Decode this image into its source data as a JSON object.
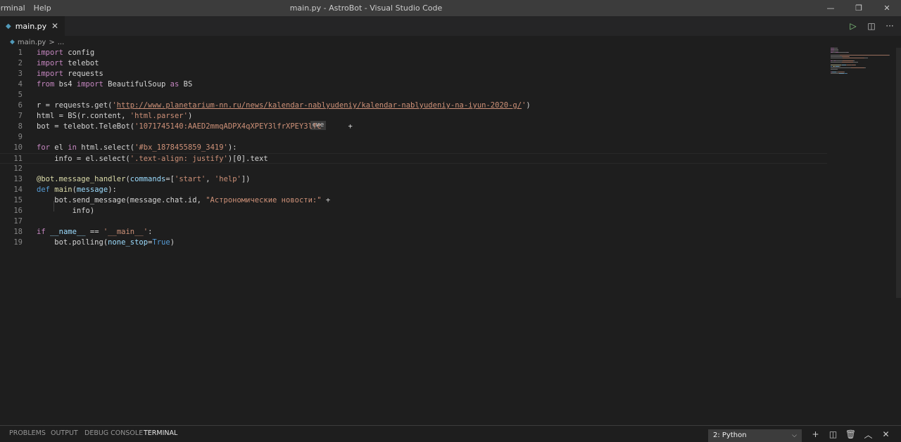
{
  "titlebar": {
    "menu": [
      "erminal",
      "Help"
    ],
    "title": "main.py - AstroBot - Visual Studio Code",
    "minimize": "—",
    "restore": "❐",
    "close": "✕"
  },
  "tabs": [
    {
      "label": "main.py",
      "close": "✕"
    }
  ],
  "tab_actions": {
    "run": "▷",
    "split": "◫",
    "more": "···"
  },
  "breadcrumb": {
    "file": "main.py",
    "sep": ">",
    "more": "..."
  },
  "editor": {
    "line_numbers": [
      "1",
      "2",
      "3",
      "4",
      "5",
      "6",
      "7",
      "8",
      "9",
      "10",
      "11",
      "12",
      "13",
      "14",
      "15",
      "16",
      "17",
      "18",
      "19"
    ],
    "lines": [
      [
        {
          "t": "import",
          "c": "kw"
        },
        {
          "t": " config",
          "c": ""
        }
      ],
      [
        {
          "t": "import",
          "c": "kw"
        },
        {
          "t": " telebot",
          "c": ""
        }
      ],
      [
        {
          "t": "import",
          "c": "kw"
        },
        {
          "t": " requests",
          "c": ""
        }
      ],
      [
        {
          "t": "from",
          "c": "kw"
        },
        {
          "t": " bs4 ",
          "c": ""
        },
        {
          "t": "import",
          "c": "kw"
        },
        {
          "t": " BeautifulSoup ",
          "c": ""
        },
        {
          "t": "as",
          "c": "kw"
        },
        {
          "t": " BS",
          "c": ""
        }
      ],
      [],
      [
        {
          "t": "r = requests.get(",
          "c": ""
        },
        {
          "t": "'",
          "c": "str"
        },
        {
          "t": "http://www.planetarium-nn.ru/news/kalendar-nablyudeniy/kalendar-nablyudeniy-na-iyun-2020-g/",
          "c": "url"
        },
        {
          "t": "'",
          "c": "str"
        },
        {
          "t": ")",
          "c": ""
        }
      ],
      [
        {
          "t": "html = BS(r.content, ",
          "c": ""
        },
        {
          "t": "'html.parser'",
          "c": "str"
        },
        {
          "t": ")",
          "c": ""
        }
      ],
      [
        {
          "t": "bot = telebot.TeleBot(",
          "c": ""
        },
        {
          "t": "'1071745140:AAED2mmqADPX4qXPEY3lfr",
          "c": "str"
        },
        {
          "t": "XPEY3lfc",
          "c": "str"
        },
        {
          "t": "      +",
          "c": ""
        }
      ],
      [],
      [
        {
          "t": "for",
          "c": "kw"
        },
        {
          "t": " el ",
          "c": ""
        },
        {
          "t": "in",
          "c": "kw"
        },
        {
          "t": " html.select(",
          "c": ""
        },
        {
          "t": "'#bx_1878455859_3419'",
          "c": "str"
        },
        {
          "t": "):",
          "c": ""
        }
      ],
      [
        {
          "t": "    info = el.select(",
          "c": ""
        },
        {
          "t": "'.text-align: justify'",
          "c": "str"
        },
        {
          "t": ")[0].text",
          "c": ""
        }
      ],
      [],
      [
        {
          "t": "@bot.message_handler",
          "c": "dec"
        },
        {
          "t": "(",
          "c": ""
        },
        {
          "t": "commands",
          "c": "param"
        },
        {
          "t": "=[",
          "c": ""
        },
        {
          "t": "'start'",
          "c": "str"
        },
        {
          "t": ", ",
          "c": ""
        },
        {
          "t": "'help'",
          "c": "str"
        },
        {
          "t": "])",
          "c": ""
        }
      ],
      [
        {
          "t": "def",
          "c": "kw2"
        },
        {
          "t": " ",
          "c": ""
        },
        {
          "t": "main",
          "c": "fn"
        },
        {
          "t": "(",
          "c": ""
        },
        {
          "t": "message",
          "c": "param"
        },
        {
          "t": "):",
          "c": ""
        }
      ],
      [
        {
          "t": "    bot.send_message(message.chat.id, ",
          "c": ""
        },
        {
          "t": "\"Астрономические новости:\"",
          "c": "str"
        },
        {
          "t": " +",
          "c": ""
        }
      ],
      [
        {
          "t": "        info)",
          "c": ""
        }
      ],
      [],
      [
        {
          "t": "if",
          "c": "kw"
        },
        {
          "t": " ",
          "c": ""
        },
        {
          "t": "__name__",
          "c": "param"
        },
        {
          "t": " == ",
          "c": ""
        },
        {
          "t": "'__main__'",
          "c": "str"
        },
        {
          "t": ":",
          "c": ""
        }
      ],
      [
        {
          "t": "    bot.polling(",
          "c": ""
        },
        {
          "t": "none_stop",
          "c": "param"
        },
        {
          "t": "=",
          "c": ""
        },
        {
          "t": "True",
          "c": "kw2"
        },
        {
          "t": ")",
          "c": ""
        }
      ]
    ],
    "hint_text": "сие"
  },
  "panel": {
    "tabs": [
      "PROBLEMS",
      "OUTPUT",
      "DEBUG CONSOLE",
      "TERMINAL"
    ],
    "active_tab": "TERMINAL",
    "terminal_select": "2: Python",
    "actions": {
      "add": "+",
      "split": "◫",
      "trash": "🗑",
      "maximize": "︿",
      "close": "✕"
    }
  },
  "colors": {
    "keyword": "#c586c0",
    "keyword_blue": "#569cd6",
    "string": "#ce9178",
    "function": "#dcdcaa",
    "param": "#9cdcfe",
    "run_icon": "#89d185",
    "python_icon": "#519aba"
  }
}
